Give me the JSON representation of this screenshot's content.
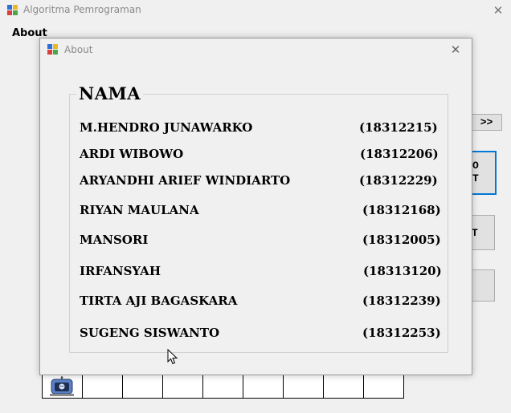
{
  "main_window": {
    "title": "Algoritma Pemrograman",
    "close_glyph": "✕",
    "menu": {
      "about": "About"
    },
    "buttons": {
      "next": ">>",
      "btn2_text": "O\nT",
      "btn3_text": "T"
    }
  },
  "dialog": {
    "title": "About",
    "close_glyph": "✕",
    "group_title": "NAMA",
    "members": [
      {
        "name": "M.HENDRO JUNAWARKO",
        "nim": "(18312215)"
      },
      {
        "name": "ARDI WIBOWO",
        "nim": "(18312206)"
      },
      {
        "name": "ARYANDHI ARIEF WINDIARTO",
        "nim": "(18312229)"
      },
      {
        "name": "RIYAN MAULANA",
        "nim": "(18312168)"
      },
      {
        "name": "MANSORI",
        "nim": "(18312005)"
      },
      {
        "name": "IRFANSYAH",
        "nim": "(18313120)"
      },
      {
        "name": "TIRTA AJI BAGASKARA",
        "nim": "(18312239)"
      },
      {
        "name": "SUGENG SISWANTO",
        "nim": "(18312253)"
      }
    ]
  },
  "icons": {
    "app": "windows-forms-icon",
    "dialog": "windows-forms-icon",
    "robot": "robot-icon",
    "cursor": "mouse-cursor-icon"
  },
  "colors": {
    "focus_border": "#0078d7",
    "background": "#f0f0f0"
  }
}
